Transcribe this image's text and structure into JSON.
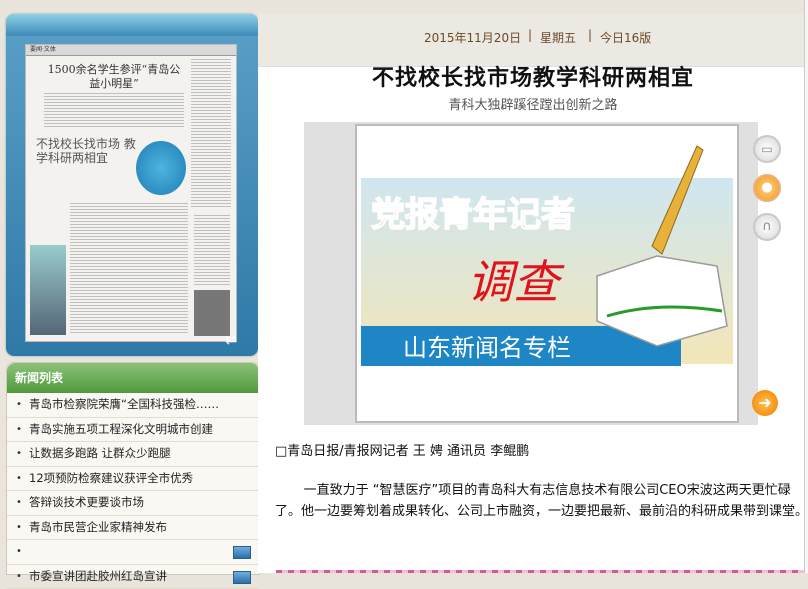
{
  "thumbnail": {
    "paper_header": "要闻·文体",
    "paper_headline1": "1500余名学生参评“青岛公益小明星”",
    "paper_headline2": "不找校长找市场 教学科研两相宜",
    "refresh_icon": "refresh-icon"
  },
  "news_list": {
    "title": "新闻列表",
    "items": [
      {
        "label": "青岛市检察院荣膺“全国科技强检……",
        "video": false
      },
      {
        "label": "青岛实施五项工程深化文明城市创建",
        "video": false
      },
      {
        "label": "让数据多跑路 让群众少跑腿",
        "video": false
      },
      {
        "label": "12项预防检察建议获评全市优秀",
        "video": false
      },
      {
        "label": "答辩谈技术更要谈市场",
        "video": false
      },
      {
        "label": "青岛市民营企业家精神发布",
        "video": false
      },
      {
        "label": "",
        "video": true
      },
      {
        "label": "市委宣讲团赴胶州红岛宣讲",
        "video": true
      }
    ]
  },
  "dateline": {
    "date": "2015年11月20日",
    "weekday": "星期五",
    "edition": "今日16版"
  },
  "article": {
    "title": "不找校长找市场教学科研两相宜",
    "subtitle": "青科大独辟蹊径蹚出创新之路",
    "image_banner_top": "党报青年记者",
    "image_banner_mid": "调查",
    "image_banner_bottom": "山东新闻名专栏",
    "byline": "□青岛日报/青报网记者 王 娉 通讯员 李鲲鹏",
    "body": "一直致力于 “智慧医疗”项目的青岛科大有志信息技术有限公司CEO宋波这两天更忙碌了。他一边要筹划着成果转化、公司上市融资，一边要把最新、最前沿的科研成果带到课堂。"
  },
  "side_buttons": [
    "video-icon",
    "person-icon",
    "headphones-icon"
  ],
  "next_button": "arrow-right-icon",
  "colors": {
    "news_header": "#5fa64a",
    "thumb_frame": "#3d8ab8",
    "accent_orange": "#f07c00",
    "banner_red": "#e0121b",
    "banner_blue": "#1f86c6"
  }
}
